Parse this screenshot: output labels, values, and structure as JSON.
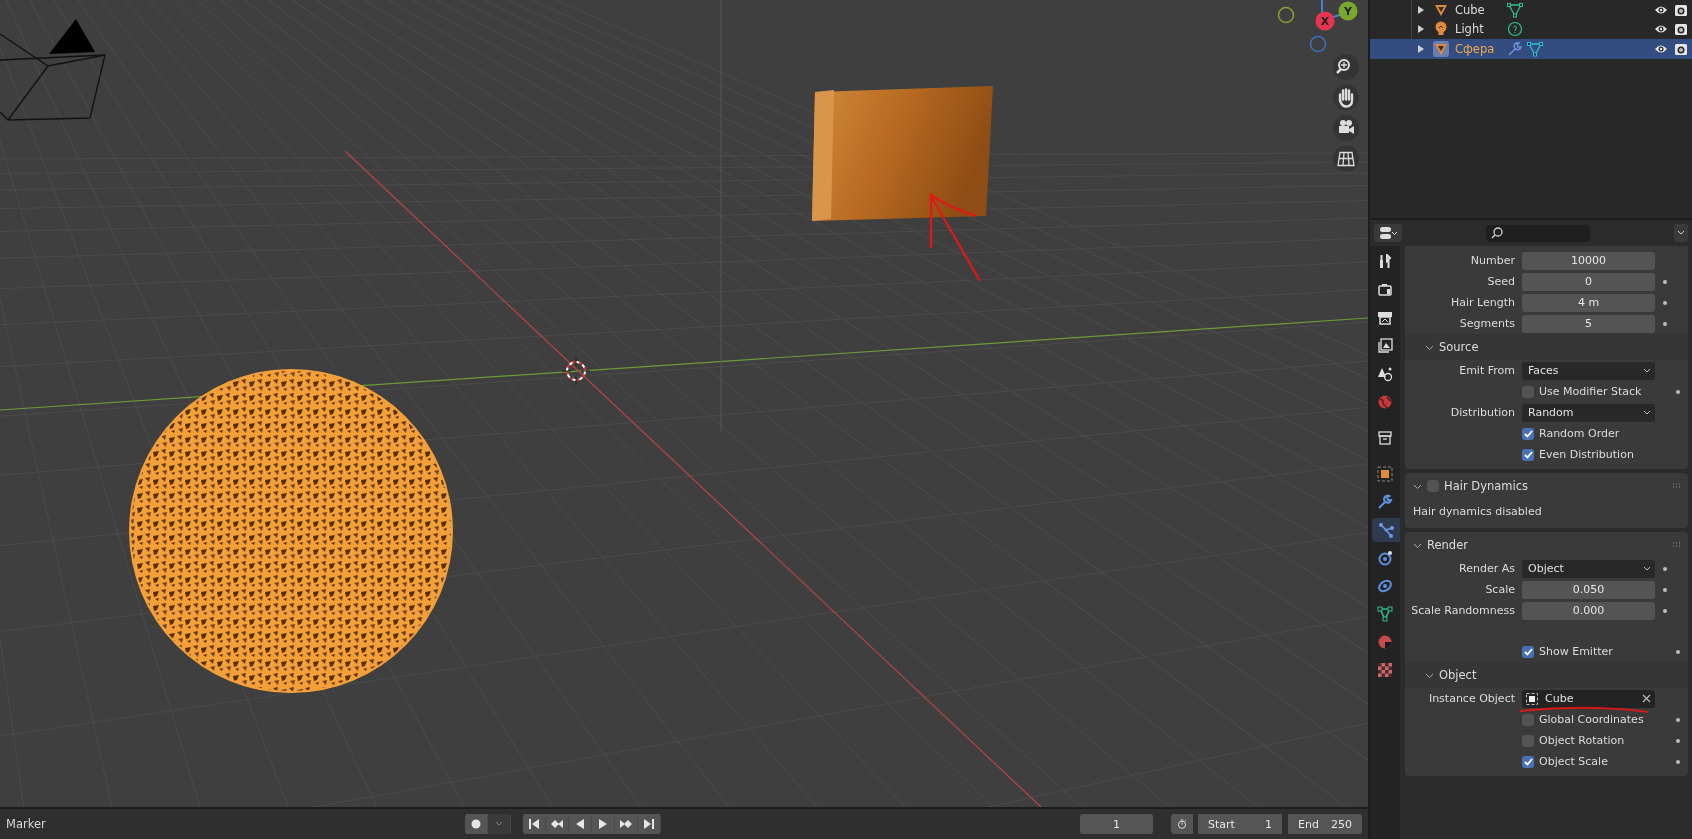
{
  "viewport": {
    "gizmo_axes": [
      {
        "label": "Y",
        "kind": "y"
      },
      {
        "label": "X",
        "kind": "x"
      }
    ]
  },
  "outliner": {
    "items": [
      {
        "name": "Cube",
        "kind": "mesh",
        "selected": false,
        "data": [
          {
            "kind": "mesh"
          }
        ]
      },
      {
        "name": "Light",
        "kind": "light",
        "selected": false,
        "data": [
          {
            "kind": "light"
          }
        ]
      },
      {
        "name": "Сфера",
        "kind": "mesh",
        "selected": true,
        "data": [
          {
            "kind": "modifier"
          },
          {
            "kind": "mesh"
          }
        ]
      }
    ]
  },
  "properties": {
    "tabs": [
      {
        "kind": "tool",
        "selected": false
      },
      {
        "kind": "render",
        "selected": false
      },
      {
        "kind": "output",
        "selected": false
      },
      {
        "kind": "view_layer",
        "selected": false
      },
      {
        "kind": "scene",
        "selected": false
      },
      {
        "kind": "world",
        "selected": false
      },
      {
        "kind": "collection",
        "selected": false
      },
      {
        "kind": "object",
        "selected": false
      },
      {
        "kind": "modifier",
        "selected": false
      },
      {
        "kind": "particles",
        "selected": true
      },
      {
        "kind": "physics",
        "selected": false
      },
      {
        "kind": "constraints",
        "selected": false
      },
      {
        "kind": "data",
        "selected": false
      },
      {
        "kind": "material",
        "selected": false
      },
      {
        "kind": "texture",
        "selected": false
      }
    ],
    "panels": [
      {
        "rows": [
          {
            "kind": "number",
            "label": "Number",
            "value": "10000",
            "dot": false
          },
          {
            "kind": "number",
            "label": "Seed",
            "value": "0",
            "dot": true
          },
          {
            "kind": "number",
            "label": "Hair Length",
            "value": "4 m",
            "dot": true
          },
          {
            "kind": "number",
            "label": "Segments",
            "value": "5",
            "dot": true
          }
        ],
        "subpanels": [
          {
            "title": "Source",
            "expanded": true,
            "rows": [
              {
                "kind": "dropdown",
                "label": "Emit From",
                "value": "Faces",
                "dot": false
              },
              {
                "kind": "checkbox",
                "text": "Use Modifier Stack",
                "checked": false,
                "dot": true
              },
              {
                "kind": "dropdown",
                "label": "Distribution",
                "value": "Random",
                "dot": false
              },
              {
                "kind": "checkbox",
                "text": "Random Order",
                "checked": true,
                "dot": false
              },
              {
                "kind": "checkbox",
                "text": "Even Distribution",
                "checked": true,
                "dot": false
              }
            ]
          }
        ]
      },
      {
        "title": "Hair Dynamics",
        "expanded": true,
        "checkbox": false,
        "rows": [
          {
            "kind": "note",
            "text": "Hair dynamics disabled"
          }
        ]
      },
      {
        "title": "Render",
        "expanded": true,
        "rows": [
          {
            "kind": "dropdown",
            "label": "Render As",
            "value": "Object",
            "dot": true
          },
          {
            "kind": "number",
            "label": "Scale",
            "value": "0.050",
            "dot": true
          },
          {
            "kind": "number",
            "label": "Scale Randomness",
            "value": "0.000",
            "dot": true
          },
          {
            "kind": "checkbox",
            "text": "Show Emitter",
            "checked": true,
            "dot": true
          }
        ],
        "subpanels": [
          {
            "title": "Object",
            "expanded": true,
            "rows": [
              {
                "kind": "object",
                "label": "Instance Object",
                "value": "Cube",
                "dot": false,
                "underlined": true
              },
              {
                "kind": "checkbox",
                "text": "Global Coordinates",
                "checked": false,
                "dot": true
              },
              {
                "kind": "checkbox",
                "text": "Object Rotation",
                "checked": false,
                "dot": true
              },
              {
                "kind": "checkbox",
                "text": "Object Scale",
                "checked": true,
                "dot": true
              }
            ]
          }
        ]
      }
    ]
  },
  "timeline": {
    "menu": "Marker",
    "current_frame": "1",
    "start_label": "Start",
    "start": "1",
    "end_label": "End",
    "end": "250"
  }
}
